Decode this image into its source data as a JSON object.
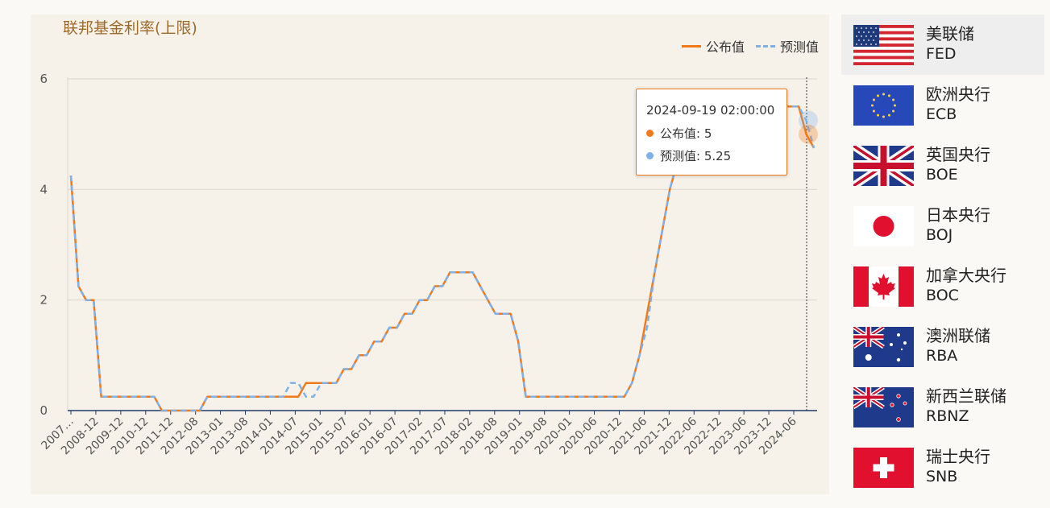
{
  "chart_data": {
    "type": "line",
    "title": "联邦基金利率(上限)",
    "legend": [
      "公布值",
      "预测值"
    ],
    "legend_placement": "top-right",
    "ylim": [
      0,
      6
    ],
    "yticks": [
      0,
      2,
      4,
      6
    ],
    "xticks": [
      "2007…",
      "2008-12",
      "2009-12",
      "2010-12",
      "2011-12",
      "2012-08",
      "2013-01",
      "2013-08",
      "2014-01",
      "2014-07",
      "2015-01",
      "2015-07",
      "2016-01",
      "2016-07",
      "2017-02",
      "2017-07",
      "2018-02",
      "2018-08",
      "2019-01",
      "2019-08",
      "2020-01",
      "2020-06",
      "2020-12",
      "2021-06",
      "2021-12",
      "2022-06",
      "2022-12",
      "2023-06",
      "2023-12",
      "2024-06"
    ],
    "colors": {
      "actual": "#f07a1a",
      "forecast": "#7fb0e8",
      "grid": "#dcd6cc",
      "axis": "#1f3a6b"
    },
    "series": [
      {
        "name": "公布值",
        "values": [
          4.25,
          2.25,
          2,
          2,
          0.25,
          0.25,
          0.25,
          0.25,
          0.25,
          0.25,
          0.25,
          0.25,
          0,
          0,
          0,
          0,
          0,
          0,
          0.25,
          0.25,
          0.25,
          0.25,
          0.25,
          0.25,
          0.25,
          0.25,
          0.25,
          0.25,
          0.25,
          0.25,
          0.25,
          0.5,
          0.5,
          0.5,
          0.5,
          0.5,
          0.75,
          0.75,
          1,
          1,
          1.25,
          1.25,
          1.5,
          1.5,
          1.75,
          1.75,
          2,
          2,
          2.25,
          2.25,
          2.5,
          2.5,
          2.5,
          2.5,
          2.25,
          2,
          1.75,
          1.75,
          1.75,
          1.25,
          0.25,
          0.25,
          0.25,
          0.25,
          0.25,
          0.25,
          0.25,
          0.25,
          0.25,
          0.25,
          0.25,
          0.25,
          0.25,
          0.25,
          0.5,
          1,
          1.75,
          2.5,
          3.25,
          4,
          4.5,
          4.75,
          5,
          5.25,
          5.25,
          5.5,
          5.5,
          5.5,
          5.5,
          5.5,
          5.5,
          5.5,
          5.5,
          5.5,
          5.5,
          5.5,
          5.5,
          5,
          4.75
        ]
      },
      {
        "name": "预测值",
        "values": [
          4.25,
          2.25,
          2,
          2,
          0.25,
          0.25,
          0.25,
          0.25,
          0.25,
          0.25,
          0.25,
          0.25,
          0,
          0,
          0,
          0,
          0,
          0,
          0.25,
          0.25,
          0.25,
          0.25,
          0.25,
          0.25,
          0.25,
          0.25,
          0.25,
          0.25,
          0.25,
          0.5,
          0.5,
          0.25,
          0.25,
          0.5,
          0.5,
          0.5,
          0.75,
          0.75,
          1,
          1,
          1.25,
          1.25,
          1.5,
          1.5,
          1.75,
          1.75,
          2,
          2,
          2.25,
          2.25,
          2.5,
          2.5,
          2.5,
          2.5,
          2.25,
          2,
          1.75,
          1.75,
          1.75,
          1.25,
          0.25,
          0.25,
          0.25,
          0.25,
          0.25,
          0.25,
          0.25,
          0.25,
          0.25,
          0.25,
          0.25,
          0.25,
          0.25,
          0.25,
          0.5,
          1,
          1.5,
          2.5,
          3.25,
          4,
          4.5,
          4.75,
          5,
          5.25,
          5.25,
          5.5,
          5.5,
          5.5,
          5.5,
          5.5,
          5.5,
          5.5,
          5.5,
          5.5,
          5.5,
          5.5,
          5.5,
          5.25,
          4.75
        ]
      }
    ]
  },
  "tooltip": {
    "time": "2024-09-19 02:00:00",
    "actual_label": "公布值: 5",
    "forecast_label": "预测值: 5.25"
  },
  "sidebar": {
    "banks": [
      {
        "name": "美联储",
        "code": "FED",
        "flag": "us-flag-icon"
      },
      {
        "name": "欧洲央行",
        "code": "ECB",
        "flag": "eu-flag-icon"
      },
      {
        "name": "英国央行",
        "code": "BOE",
        "flag": "uk-flag-icon"
      },
      {
        "name": "日本央行",
        "code": "BOJ",
        "flag": "japan-flag-icon"
      },
      {
        "name": "加拿大央行",
        "code": "BOC",
        "flag": "canada-flag-icon"
      },
      {
        "name": "澳洲联储",
        "code": "RBA",
        "flag": "australia-flag-icon"
      },
      {
        "name": "新西兰联储",
        "code": "RBNZ",
        "flag": "new-zealand-flag-icon"
      },
      {
        "name": "瑞士央行",
        "code": "SNB",
        "flag": "swiss-flag-icon"
      }
    ]
  }
}
